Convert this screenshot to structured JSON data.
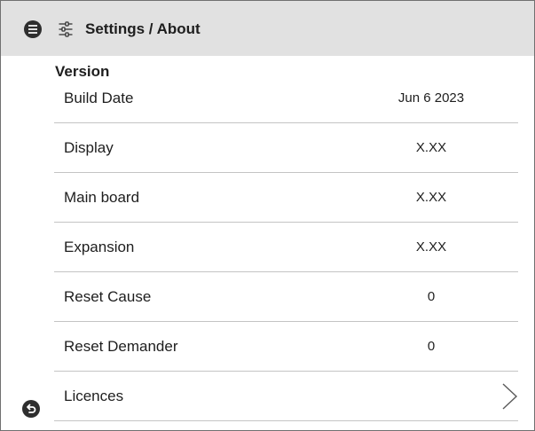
{
  "header": {
    "menu_icon": "hamburger-menu-icon",
    "settings_icon": "sliders-icon",
    "title": "Settings / About"
  },
  "section": {
    "title": "Version"
  },
  "rows": [
    {
      "label": "Build Date",
      "value": "Jun 6 2023"
    },
    {
      "label": "Display",
      "value": "X.XX"
    },
    {
      "label": "Main board",
      "value": "X.XX"
    },
    {
      "label": "Expansion",
      "value": "X.XX"
    },
    {
      "label": "Reset Cause",
      "value": "0"
    },
    {
      "label": "Reset Demander",
      "value": "0"
    },
    {
      "label": "Licences",
      "value": null,
      "icon": "chevron-right-icon"
    }
  ],
  "footer": {
    "back_icon": "back-arrow-icon"
  },
  "colors": {
    "header_bg": "#e1e1e1",
    "text": "#1e1e1e",
    "icon": "#2e2e2e",
    "divider": "#c4c4c4",
    "border": "#707070"
  }
}
